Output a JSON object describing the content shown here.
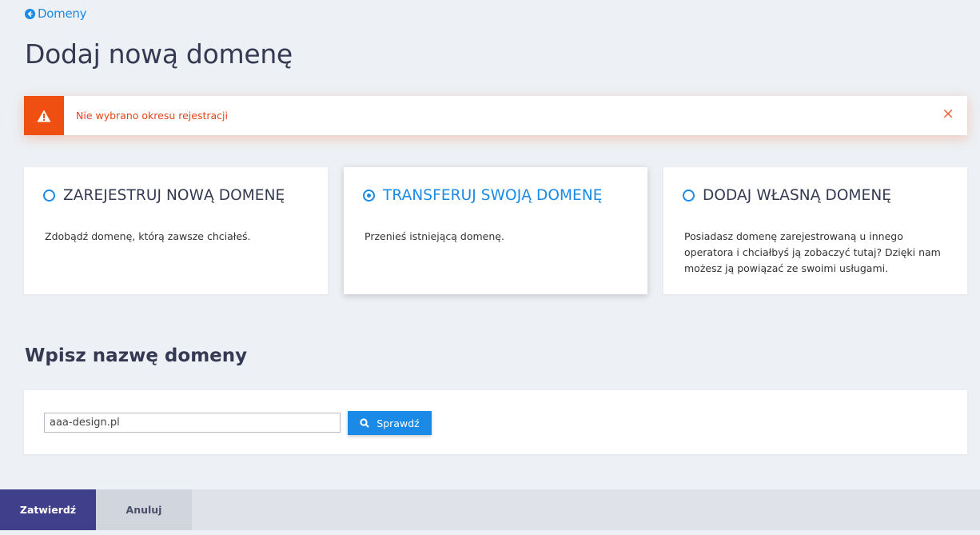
{
  "nav": {
    "back_label": "Domeny"
  },
  "page": {
    "title": "Dodaj nową domenę"
  },
  "alert": {
    "message": "Nie wybrano okresu rejestracji",
    "close_label": "×"
  },
  "options": [
    {
      "title": "ZAREJESTRUJ NOWĄ DOMENĘ",
      "description": "Zdobądź domenę, którą zawsze chciałeś.",
      "selected": false
    },
    {
      "title": "TRANSFERUJ SWOJĄ DOMENĘ",
      "description": "Przenieś istniejącą domenę.",
      "selected": true
    },
    {
      "title": "DODAJ WŁASNĄ DOMENĘ",
      "description": "Posiadasz domenę zarejestrowaną u innego operatora i chciałbyś ją zobaczyć tutaj? Dzięki nam możesz ją powiązać ze swoimi usługami.",
      "selected": false
    }
  ],
  "domain_section": {
    "title": "Wpisz nazwę domeny",
    "input_value": "aaa-design.pl",
    "check_label": "Sprawdź"
  },
  "footer": {
    "confirm_label": "Zatwierdź",
    "cancel_label": "Anuluj"
  },
  "colors": {
    "accent": "#1a8ae6",
    "alert": "#f04f12",
    "primary_button": "#3f3f8c"
  }
}
